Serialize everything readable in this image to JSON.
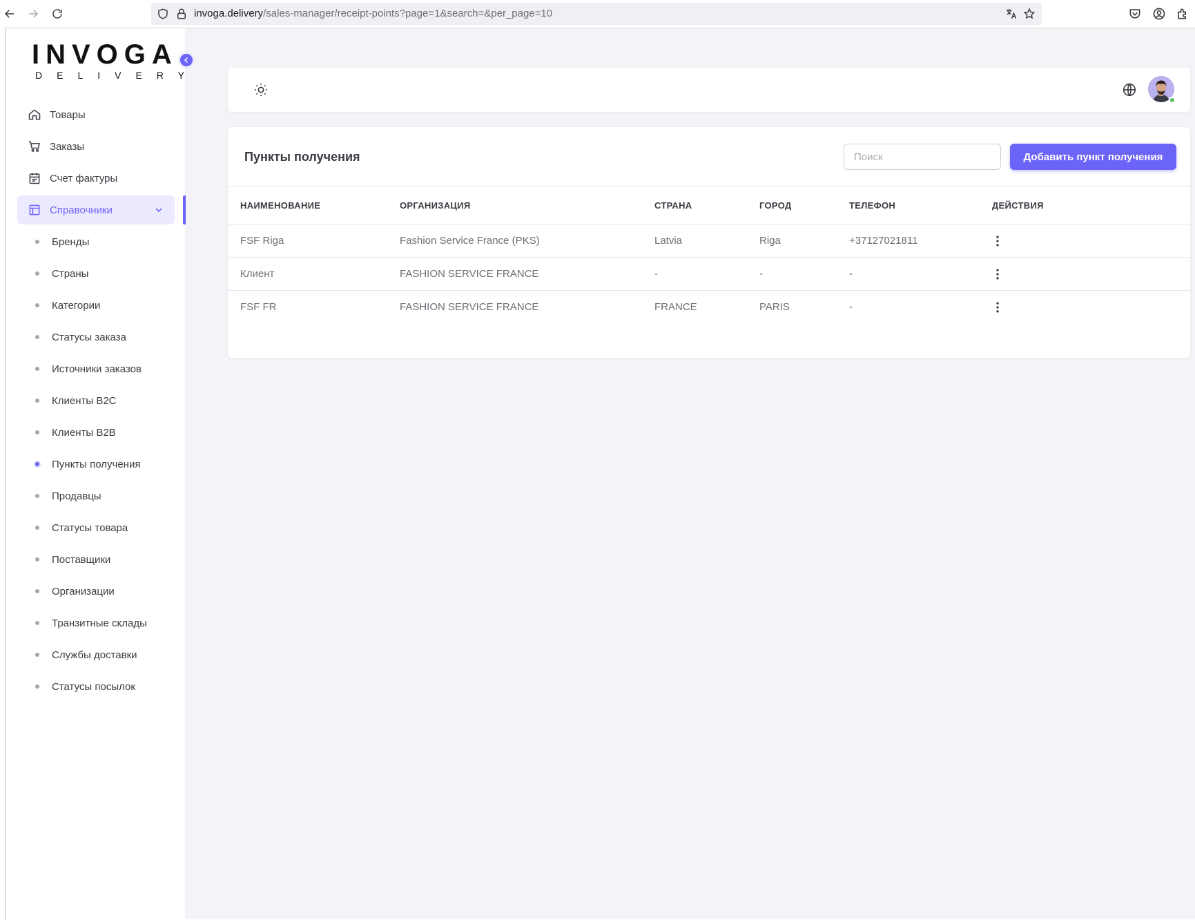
{
  "browser": {
    "url_host": "invoga.delivery",
    "url_path": "/sales-manager/receipt-points?page=1&search=&per_page=10"
  },
  "logo": {
    "main": "INVOGA",
    "sub": "DELIVERY"
  },
  "sidebar": {
    "items": [
      {
        "label": "Товары",
        "icon": "home-icon"
      },
      {
        "label": "Заказы",
        "icon": "cart-icon"
      },
      {
        "label": "Счет фактуры",
        "icon": "calendar-icon"
      },
      {
        "label": "Справочники",
        "icon": "layout-icon",
        "expanded": true
      }
    ],
    "subitems": [
      "Бренды",
      "Страны",
      "Категории",
      "Статусы заказа",
      "Источники заказов",
      "Клиенты B2C",
      "Клиенты B2B",
      "Пункты получения",
      "Продавцы",
      "Статусы товара",
      "Поставщики",
      "Организации",
      "Транзитные склады",
      "Службы доставки",
      "Статусы посылок"
    ],
    "current_subitem": "Пункты получения"
  },
  "colors": {
    "accent": "#6c63f7",
    "online": "#53c35c"
  },
  "page": {
    "title": "Пункты получения",
    "search_placeholder": "Поиск",
    "search_value": "",
    "add_button": "Добавить пункт получения"
  },
  "table": {
    "columns": [
      "НАИМЕНОВАНИЕ",
      "ОРГАНИЗАЦИЯ",
      "СТРАНА",
      "ГОРОД",
      "ТЕЛЕФОН",
      "ДЕЙСТВИЯ"
    ],
    "rows": [
      {
        "name": "FSF Riga",
        "organization": "Fashion Service France (PKS)",
        "country": "Latvia",
        "city": "Riga",
        "phone": "+37127021811"
      },
      {
        "name": "Клиент",
        "organization": "FASHION SERVICE FRANCE",
        "country": "-",
        "city": "-",
        "phone": "-"
      },
      {
        "name": "FSF FR",
        "organization": "FASHION SERVICE FRANCE",
        "country": "FRANCE",
        "city": "PARIS",
        "phone": "-"
      }
    ]
  }
}
